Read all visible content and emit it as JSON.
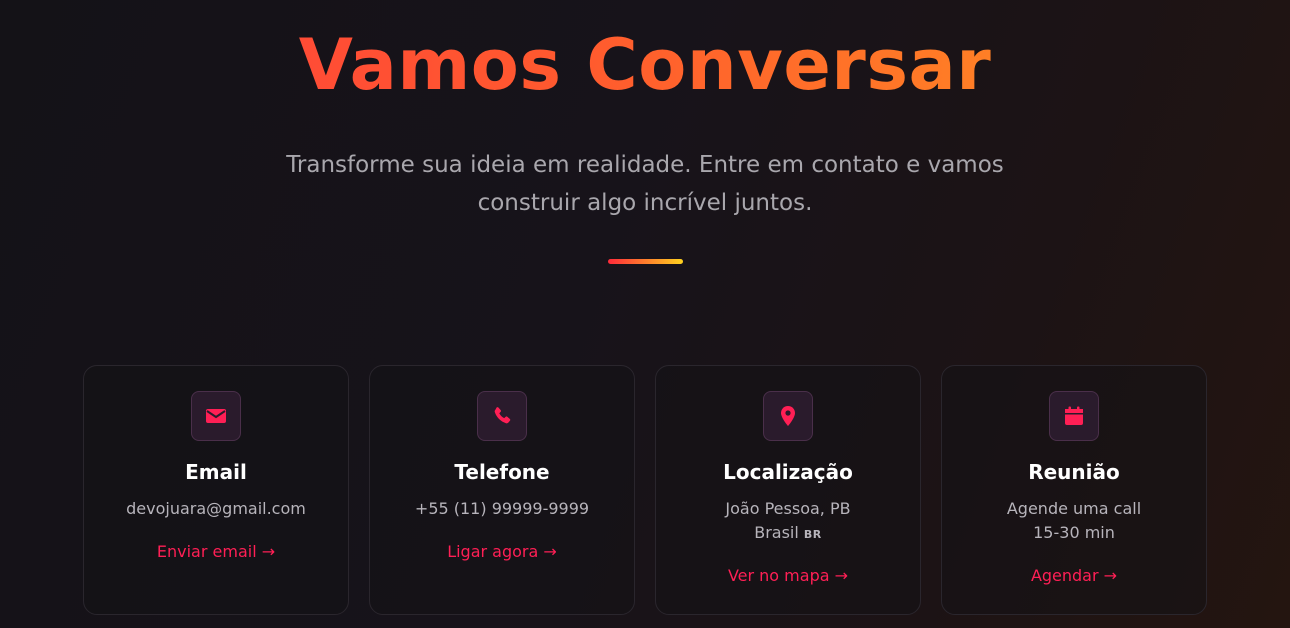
{
  "header": {
    "title": "Vamos Conversar",
    "subtitle_line1": "Transforme sua ideia em realidade. Entre em contato e vamos",
    "subtitle_line2": "construir algo incrível juntos."
  },
  "colors": {
    "accent": "#ff1f55",
    "title_gradient_start": "#ff3d3d",
    "title_gradient_end": "#ff9a1f"
  },
  "cards": [
    {
      "icon": "envelope-icon",
      "title": "Email",
      "line1": "devojuara@gmail.com",
      "link": "Enviar email →"
    },
    {
      "icon": "phone-icon",
      "title": "Telefone",
      "line1": "+55 (11) 99999-9999",
      "link": "Ligar agora →"
    },
    {
      "icon": "map-pin-icon",
      "title": "Localização",
      "line1": "João Pessoa, PB",
      "line2": "Brasil",
      "line2_badge": "BR",
      "link": "Ver no mapa →"
    },
    {
      "icon": "calendar-icon",
      "title": "Reunião",
      "line1": "Agende uma call",
      "line2": "15-30 min",
      "link": "Agendar →"
    }
  ]
}
